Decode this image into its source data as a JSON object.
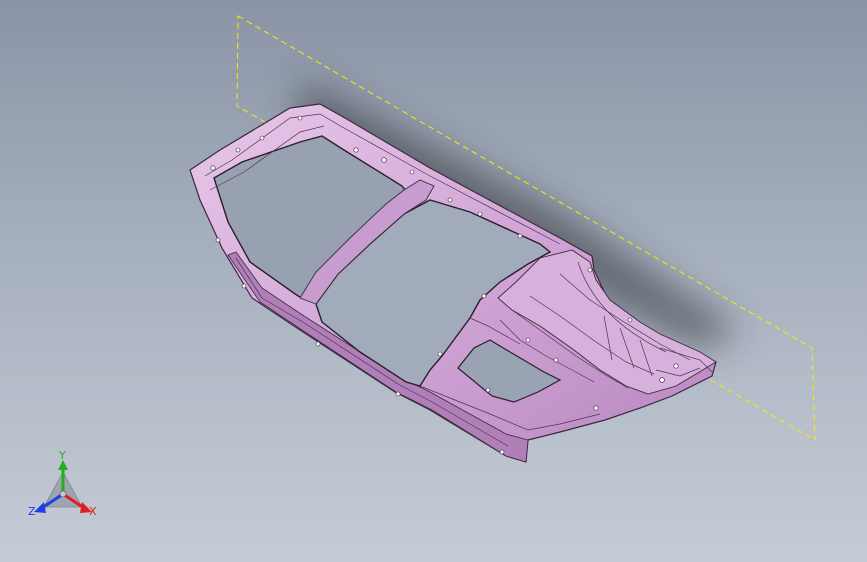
{
  "viewport": {
    "background_top": "#8a94a6",
    "background_bottom": "#c6ccd6",
    "part_color": "#d3a8d8",
    "part_edge_color": "#3a2a3e",
    "selection_box_color": "#f2f000"
  },
  "triad": {
    "icon": "xyz-triad-icon",
    "x_label": "X",
    "y_label": "Y",
    "z_label": "Z",
    "x_color": "#e02020",
    "y_color": "#20b020",
    "z_color": "#2040e0"
  }
}
